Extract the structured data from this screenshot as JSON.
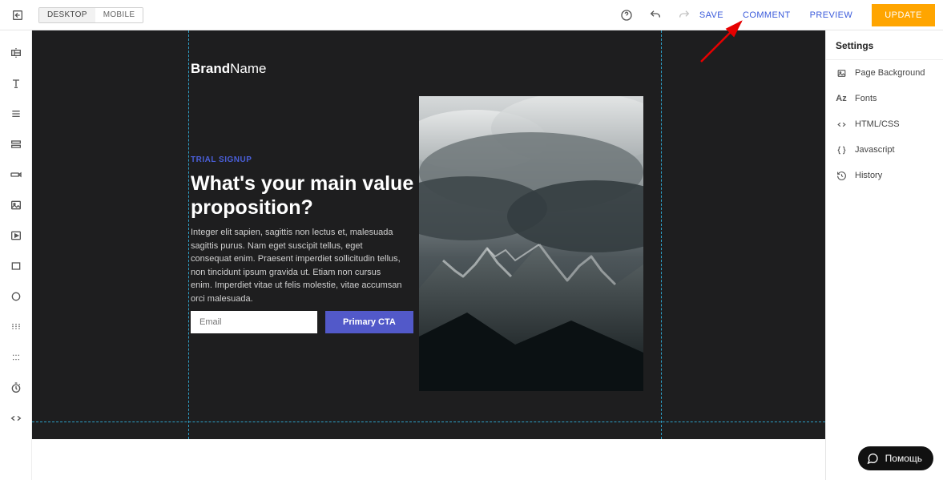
{
  "topbar": {
    "device_desktop": "DESKTOP",
    "device_mobile": "MOBILE",
    "save": "SAVE",
    "comment": "COMMENT",
    "preview": "PREVIEW",
    "update": "UPDATE"
  },
  "canvas": {
    "brand_bold": "Brand",
    "brand_light": "Name",
    "eyebrow": "TRIAL SIGNUP",
    "headline": "What's your main value proposition?",
    "body": "Integer elit sapien, sagittis non lectus et, malesuada sagittis purus. Nam eget suscipit tellus, eget consequat enim. Praesent imperdiet sollicitudin tellus, non tincidunt ipsum gravida ut. Etiam non cursus enim. Imperdiet vitae ut felis molestie, vitae accumsan orci malesuada.",
    "email_placeholder": "Email",
    "cta": "Primary CTA"
  },
  "settings": {
    "title": "Settings",
    "items": [
      {
        "icon": "image-icon",
        "label": "Page Background"
      },
      {
        "icon": "fonts-icon",
        "label": "Fonts"
      },
      {
        "icon": "code-icon",
        "label": "HTML/CSS"
      },
      {
        "icon": "braces-icon",
        "label": "Javascript"
      },
      {
        "icon": "history-icon",
        "label": "History"
      }
    ]
  },
  "help": {
    "label": "Помощь"
  },
  "left_tools": [
    "section-icon",
    "text-icon",
    "paragraph-icon",
    "list-icon",
    "form-icon",
    "image-icon",
    "video-icon",
    "box-icon",
    "circle-icon",
    "slider-icon",
    "dots-icon",
    "timer-icon",
    "embed-icon"
  ]
}
